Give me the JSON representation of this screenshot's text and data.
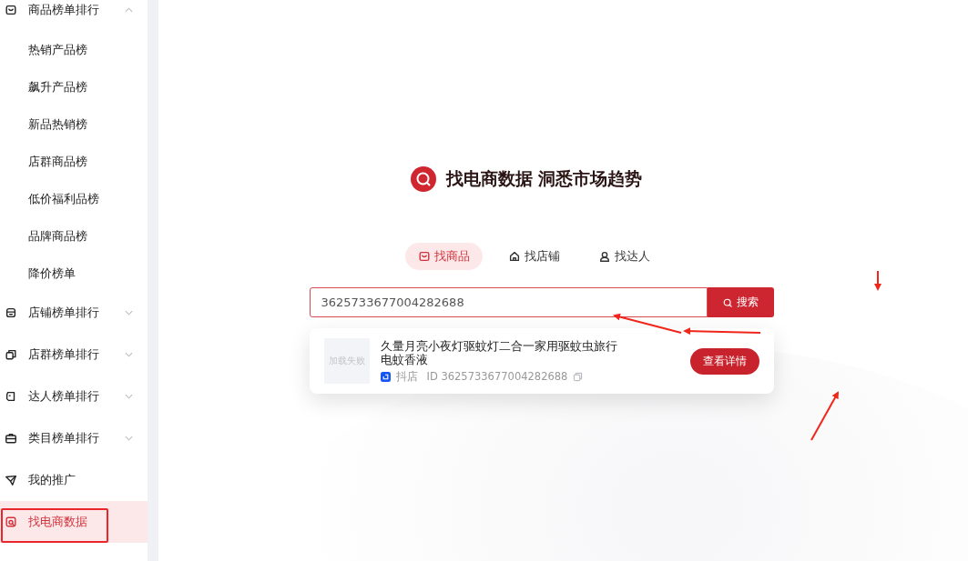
{
  "sidebar": {
    "items": [
      {
        "label": "商品榜单排行",
        "kind": "bag",
        "expanded": true,
        "selected": false,
        "children": [
          {
            "label": "热销产品榜",
            "selected": false
          },
          {
            "label": "飙升产品榜",
            "selected": false
          },
          {
            "label": "新品热销榜",
            "selected": false
          },
          {
            "label": "店群商品榜",
            "selected": false
          },
          {
            "label": "低价福利品榜",
            "selected": false
          },
          {
            "label": "品牌商品榜",
            "selected": false
          },
          {
            "label": "降价榜单",
            "selected": false
          }
        ]
      },
      {
        "label": "店铺榜单排行",
        "kind": "store",
        "expanded": false,
        "selected": false
      },
      {
        "label": "店群榜单排行",
        "kind": "stores",
        "expanded": false,
        "selected": false
      },
      {
        "label": "达人榜单排行",
        "kind": "person",
        "expanded": false,
        "selected": false
      },
      {
        "label": "类目榜单排行",
        "kind": "category",
        "expanded": false,
        "selected": false
      },
      {
        "label": "我的推广",
        "kind": "promo",
        "selected": false
      },
      {
        "label": "找电商数据",
        "kind": "search",
        "selected": true
      }
    ]
  },
  "main": {
    "title": "找电商数据 洞悉市场趋势",
    "tabs": [
      {
        "label": "找商品",
        "kind": "bag",
        "selected": true
      },
      {
        "label": "找店铺",
        "kind": "home",
        "selected": false
      },
      {
        "label": "找达人",
        "kind": "person",
        "selected": false
      }
    ],
    "search": {
      "value": "3625733677004282688",
      "button": "搜索"
    },
    "result": {
      "image_text": "加载失败",
      "title": "久量月亮小夜灯驱蚊灯二合一家用驱蚊虫旅行电蚊香液",
      "platform": "抖店",
      "id": "ID 3625733677004282688",
      "button": "查看详情"
    }
  }
}
